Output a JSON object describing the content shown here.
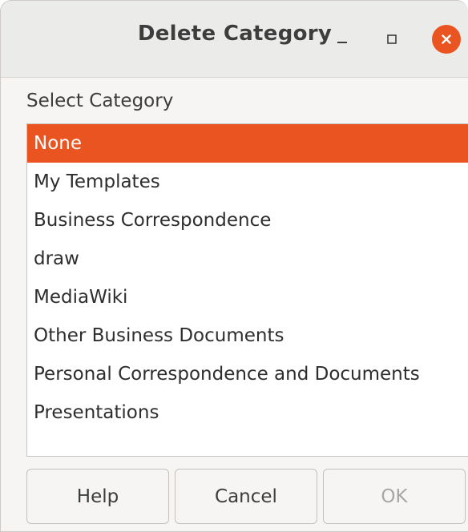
{
  "window": {
    "title": "Delete Category"
  },
  "form": {
    "label": "Select Category"
  },
  "categories": [
    {
      "label": "None",
      "selected": true
    },
    {
      "label": "My Templates",
      "selected": false
    },
    {
      "label": "Business Correspondence",
      "selected": false
    },
    {
      "label": "draw",
      "selected": false
    },
    {
      "label": "MediaWiki",
      "selected": false
    },
    {
      "label": "Other Business Documents",
      "selected": false
    },
    {
      "label": "Personal Correspondence and Documents",
      "selected": false
    },
    {
      "label": "Presentations",
      "selected": false
    }
  ],
  "buttons": {
    "help": "Help",
    "cancel": "Cancel",
    "ok": "OK",
    "ok_disabled": true
  },
  "colors": {
    "accent": "#e95420",
    "titlebar": "#ebebea",
    "background": "#f6f5f4"
  },
  "icons": {
    "minimize": "minimize-icon",
    "maximize": "maximize-icon",
    "close": "close-icon"
  }
}
